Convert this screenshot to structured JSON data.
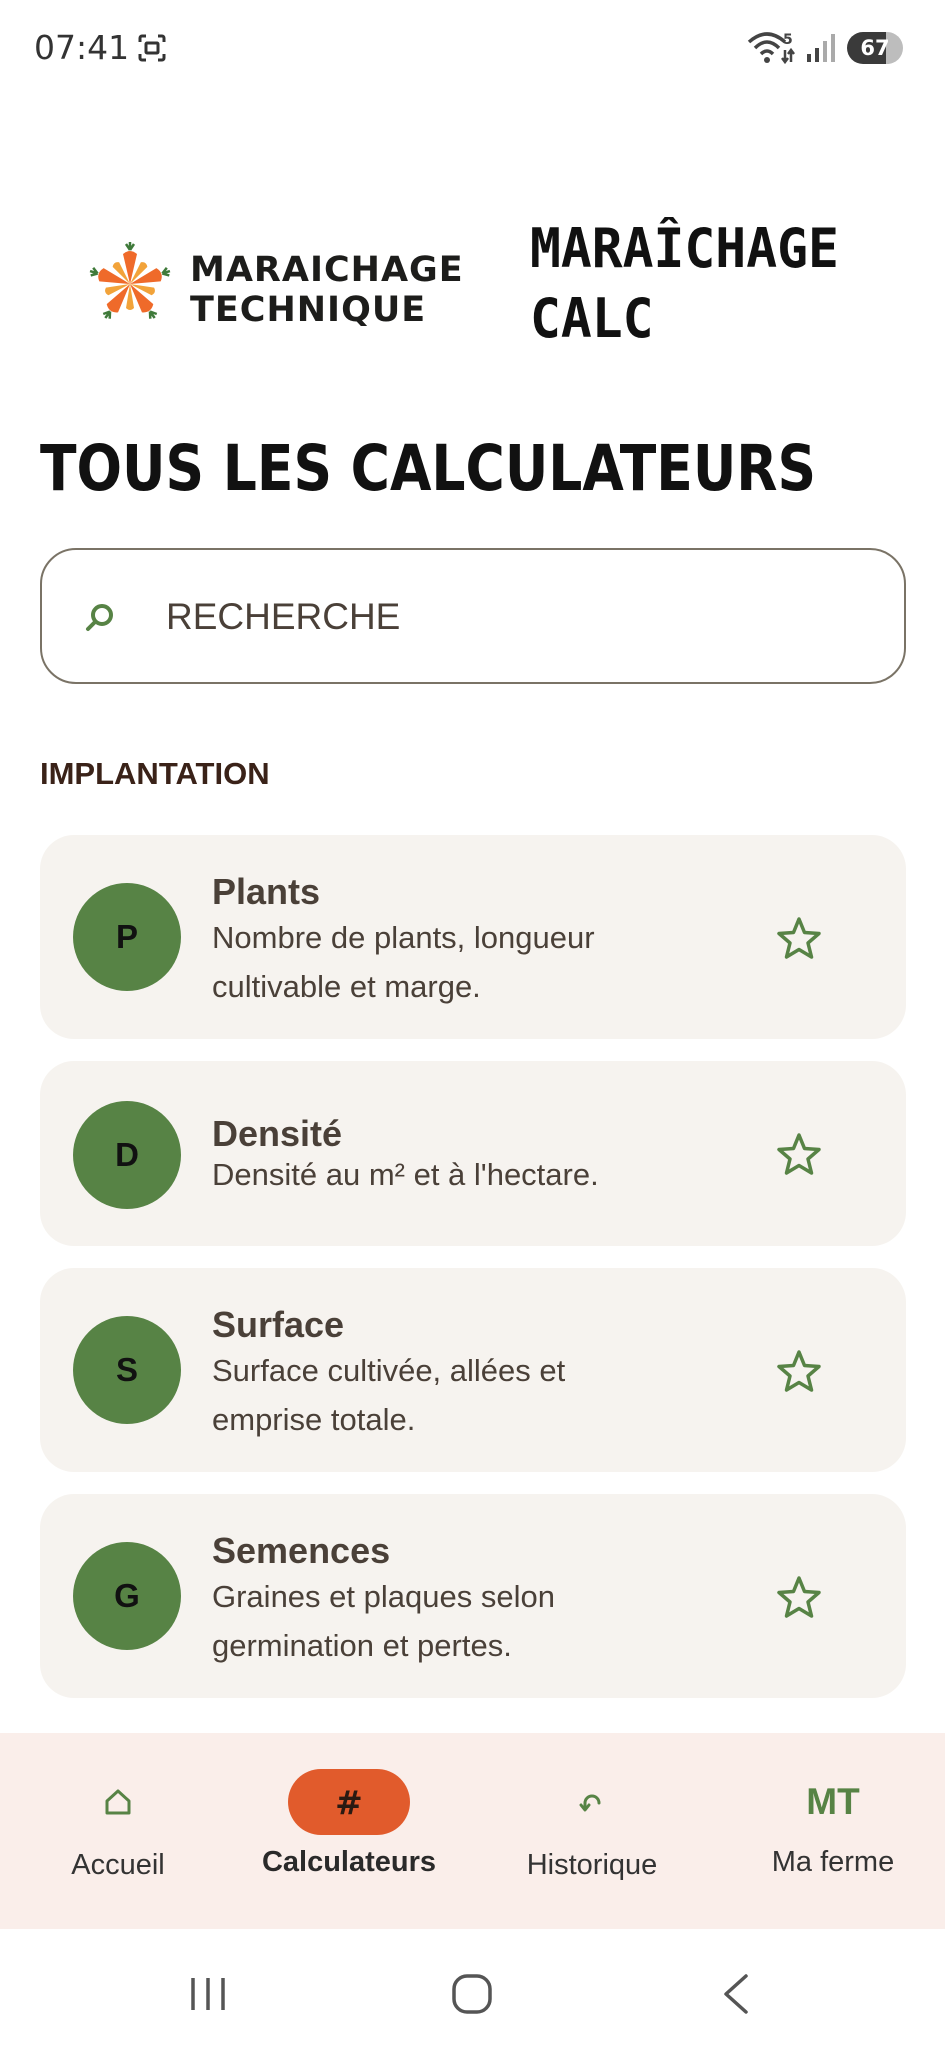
{
  "status_bar": {
    "time": "07:41",
    "battery": "67",
    "wifi_badge": "5"
  },
  "header": {
    "logo_text_line1": "MARAICHAGE",
    "logo_text_line2": "TECHNIQUE",
    "app_title_line1": "MARAÎCHAGE",
    "app_title_line2": "CALC"
  },
  "page": {
    "title": "TOUS LES CALCULATEURS"
  },
  "search": {
    "placeholder": "RECHERCHE",
    "value": ""
  },
  "section": {
    "label": "IMPLANTATION"
  },
  "calculators": [
    {
      "letter": "P",
      "title": "Plants",
      "description": "Nombre de plants, longueur cultivable et marge.",
      "icon": "star-outline-icon"
    },
    {
      "letter": "D",
      "title": "Densité",
      "description": "Densité au m² et à l'hectare.",
      "icon": "star-outline-icon"
    },
    {
      "letter": "S",
      "title": "Surface",
      "description": "Surface cultivée, allées et emprise totale.",
      "icon": "star-outline-icon"
    },
    {
      "letter": "G",
      "title": "Semences",
      "description": "Graines et plaques selon germination et pertes.",
      "icon": "star-outline-icon"
    }
  ],
  "bottom_nav": {
    "items": [
      {
        "label": "Accueil",
        "icon": "home-icon"
      },
      {
        "label": "Calculateurs",
        "icon": "#",
        "active": true
      },
      {
        "label": "Historique",
        "icon": "history-icon"
      },
      {
        "label": "Ma ferme",
        "icon": "MT"
      }
    ]
  },
  "colors": {
    "accent_green": "#578345",
    "active_orange": "#e15b2c",
    "card_bg": "#f6f3ef",
    "nav_bg": "#faeeea"
  }
}
